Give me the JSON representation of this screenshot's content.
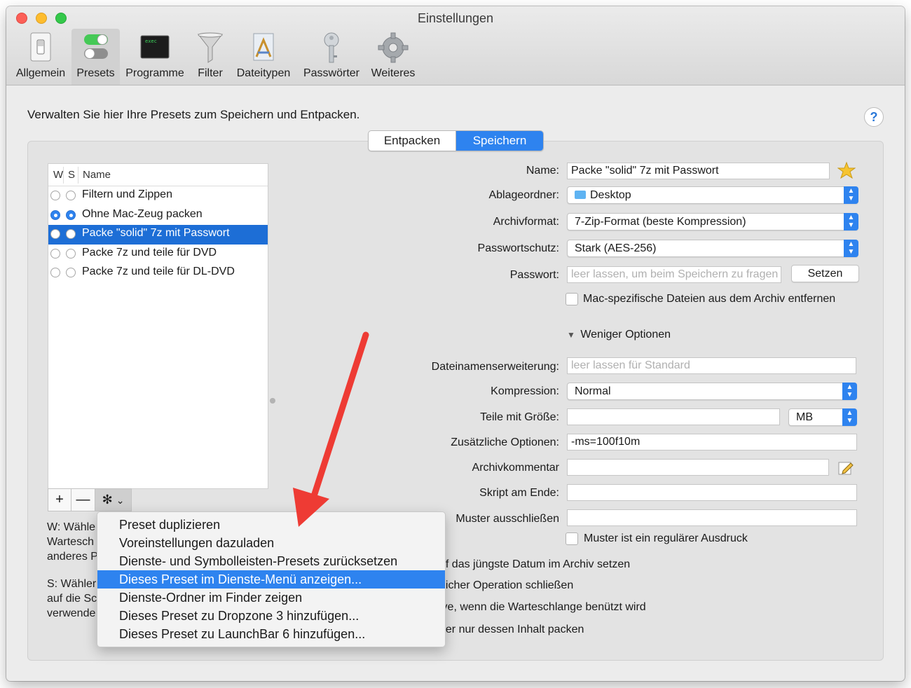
{
  "window": {
    "title": "Einstellungen"
  },
  "toolbar": {
    "items": [
      {
        "label": "Allgemein",
        "icon": "switch-icon"
      },
      {
        "label": "Presets",
        "icon": "toggles-icon",
        "active": true
      },
      {
        "label": "Programme",
        "icon": "terminal-icon",
        "badge": "exec"
      },
      {
        "label": "Filter",
        "icon": "funnel-icon"
      },
      {
        "label": "Dateitypen",
        "icon": "document-icon"
      },
      {
        "label": "Passwörter",
        "icon": "key-icon"
      },
      {
        "label": "Weiteres",
        "icon": "gear-icon"
      }
    ]
  },
  "intro": "Verwalten Sie hier Ihre Presets zum Speichern und Entpacken.",
  "help": "?",
  "segments": {
    "left": "Entpacken",
    "right": "Speichern",
    "selected": "Speichern"
  },
  "presets": {
    "headers": {
      "w": "W",
      "s": "S",
      "name": "Name"
    },
    "rows": [
      {
        "name": "Filtern und Zippen",
        "w": false,
        "s": false
      },
      {
        "name": "Ohne Mac-Zeug packen",
        "w": true,
        "s": true
      },
      {
        "name": "Packe \"solid\" 7z mit Passwort",
        "w": false,
        "s": false,
        "selected": true
      },
      {
        "name": "Packe 7z und teile für DVD",
        "w": false,
        "s": false
      },
      {
        "name": "Packe 7z und teile für DL-DVD",
        "w": false,
        "s": false
      }
    ],
    "buttons": {
      "add": "+",
      "remove": "—",
      "gear": "✻",
      "chevron": "⌄"
    }
  },
  "info": {
    "w_lines": [
      "W: Wähle",
      "Wartesch",
      "anderes P"
    ],
    "s_lines": [
      "S: Wähler",
      "auf die Sc",
      "verwende"
    ]
  },
  "form": {
    "name_label": "Name:",
    "name_value": "Packe \"solid\" 7z mit Passwort",
    "folder_label": "Ablageordner:",
    "folder_value": "Desktop",
    "format_label": "Archivformat:",
    "format_value": "7-Zip-Format (beste Kompression)",
    "pwprotect_label": "Passwortschutz:",
    "pwprotect_value": "Stark (AES-256)",
    "password_label": "Passwort:",
    "password_placeholder": "leer lassen, um beim Speichern zu fragen",
    "set_button": "Setzen",
    "mac_files_label": "Mac-spezifische Dateien aus dem Archiv entfernen",
    "fewer_options": "Weniger Optionen",
    "extension_label": "Dateinamenserweiterung:",
    "extension_placeholder": "leer lassen für Standard",
    "compression_label": "Kompression:",
    "compression_value": "Normal",
    "split_label": "Teile mit Größe:",
    "split_value": "",
    "split_unit": "MB",
    "extra_label": "Zusätzliche Optionen:",
    "extra_value": "-ms=100f10m",
    "comment_label": "Archivkommentar",
    "comment_value": "",
    "script_label": "Skript am Ende:",
    "script_value": "",
    "exclude_label": "Muster ausschließen",
    "exclude_value": "",
    "regex_label": "Muster ist ein regulärer Ausdruck",
    "date_label": "uf das jüngste Datum im Archiv setzen",
    "close_label": "eicher Operation schließen",
    "queue_label": "ive, wenn die Warteschlange benützt wird",
    "contents_label": "ner nur dessen Inhalt packen"
  },
  "context_menu": {
    "items": [
      "Preset duplizieren",
      "Voreinstellungen dazuladen",
      "Dienste- und Symbolleisten-Presets zurücksetzen",
      "Dieses Preset im Dienste-Menü anzeigen...",
      "Dienste-Ordner im Finder zeigen",
      "Dieses Preset zu Dropzone 3 hinzufügen...",
      "Dieses Preset zu LaunchBar 6 hinzufügen..."
    ],
    "highlighted_index": 3
  },
  "colors": {
    "accent": "#2e83ef",
    "selection": "#1d6ed6",
    "arrow": "#ee3b34"
  }
}
